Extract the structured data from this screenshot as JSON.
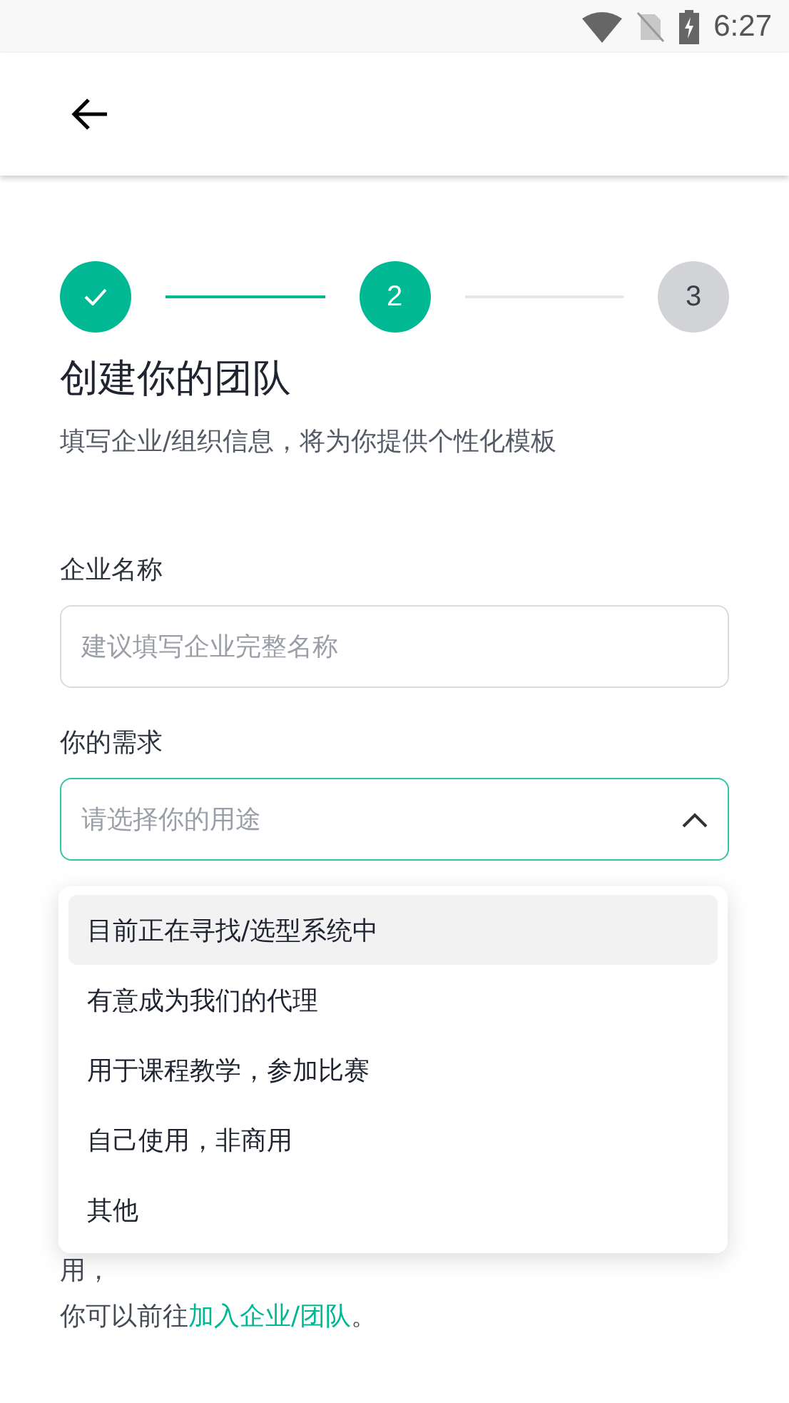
{
  "status_bar": {
    "time": "6:27"
  },
  "steps": [
    {
      "kind": "done"
    },
    {
      "label": "2",
      "kind": "current"
    },
    {
      "label": "3",
      "kind": "upcoming"
    }
  ],
  "title": "创建你的团队",
  "subtitle": "填写企业/组织信息，将为你提供个性化模板",
  "company_field": {
    "label": "企业名称",
    "placeholder": "建议填写企业完整名称"
  },
  "need_field": {
    "label": "你的需求",
    "placeholder": "请选择你的用途",
    "expanded": true
  },
  "options": [
    {
      "label": "目前正在寻找/选型系统中",
      "selected": true
    },
    {
      "label": "有意成为我们的代理",
      "selected": false
    },
    {
      "label": "用于课程教学，参加比赛",
      "selected": false
    },
    {
      "label": "自己使用，非商用",
      "selected": false
    },
    {
      "label": "其他",
      "selected": false
    }
  ],
  "footer": {
    "line": "用，",
    "prefix": "你可以前往",
    "link": "加入企业/团队",
    "suffix": "。"
  }
}
